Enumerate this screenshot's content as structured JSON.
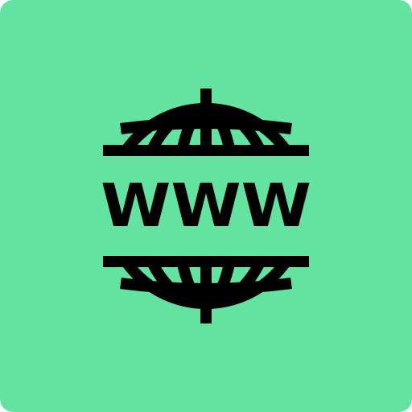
{
  "icon": {
    "name": "www-globe-icon",
    "label": "WWW",
    "background_color": "#62E3A0",
    "foreground_color": "#000000"
  }
}
